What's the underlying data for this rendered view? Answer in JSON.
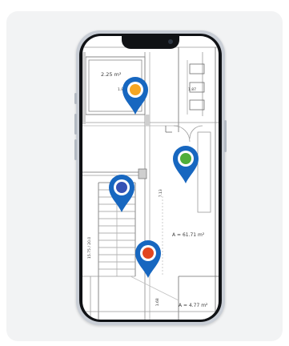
{
  "floorplan": {
    "room_area_top": "2.25 m²",
    "dim_top_left": "1.82",
    "dim_top_right": "1.87",
    "dim_vertical": "7.13",
    "dim_stair": "15.75 / 20.0",
    "room_area_main": "A = 61.71 m²",
    "room_area_bottom": "A = 4.77 m²",
    "dim_bottom": "1.68"
  },
  "pins": [
    {
      "id": "pin-yellow",
      "dot_color": "#f5a623"
    },
    {
      "id": "pin-green",
      "dot_color": "#4fae3a"
    },
    {
      "id": "pin-navy",
      "dot_color": "#3552b5"
    },
    {
      "id": "pin-red",
      "dot_color": "#e2461f"
    }
  ],
  "colors": {
    "pin_body": "#1767c0",
    "phone_frame": "#c9ced6",
    "card_background": "#f2f3f4"
  }
}
